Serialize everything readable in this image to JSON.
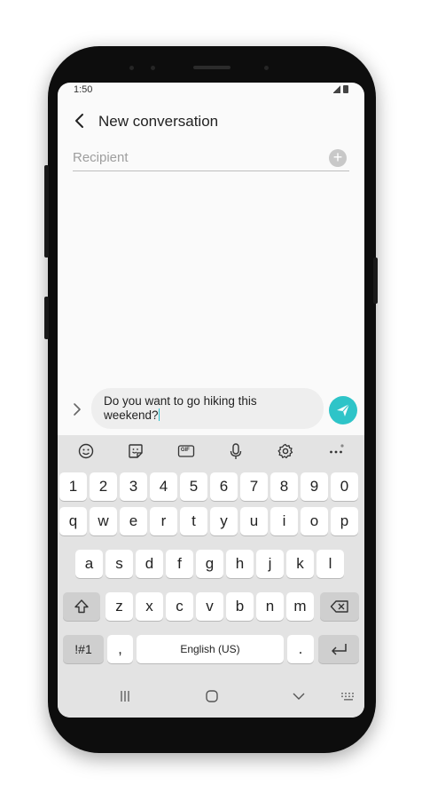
{
  "status_bar": {
    "time": "1:50"
  },
  "header": {
    "title": "New conversation"
  },
  "recipient": {
    "placeholder": "Recipient"
  },
  "composer": {
    "line1": "Do you want to go hiking this",
    "line2": "weekend?"
  },
  "keyboard": {
    "number_row": [
      "1",
      "2",
      "3",
      "4",
      "5",
      "6",
      "7",
      "8",
      "9",
      "0"
    ],
    "row1": [
      "q",
      "w",
      "e",
      "r",
      "t",
      "y",
      "u",
      "i",
      "o",
      "p"
    ],
    "row2": [
      "a",
      "s",
      "d",
      "f",
      "g",
      "h",
      "j",
      "k",
      "l"
    ],
    "row3": [
      "z",
      "x",
      "c",
      "v",
      "b",
      "n",
      "m"
    ],
    "symbols_label": "!#1",
    "comma": ",",
    "space_label": "English (US)",
    "period": ".",
    "gif_label": "GIF"
  },
  "colors": {
    "accent": "#2ec4c8",
    "keyboard_bg": "#e3e3e3",
    "phone_body": "#0d0d0d"
  },
  "icons": [
    "back-arrow",
    "add-recipient",
    "expand-arrow",
    "send",
    "emoji",
    "sticker",
    "gif",
    "microphone",
    "settings",
    "more",
    "shift",
    "backspace",
    "enter",
    "recent-apps",
    "home",
    "back",
    "keyboard-switch"
  ]
}
